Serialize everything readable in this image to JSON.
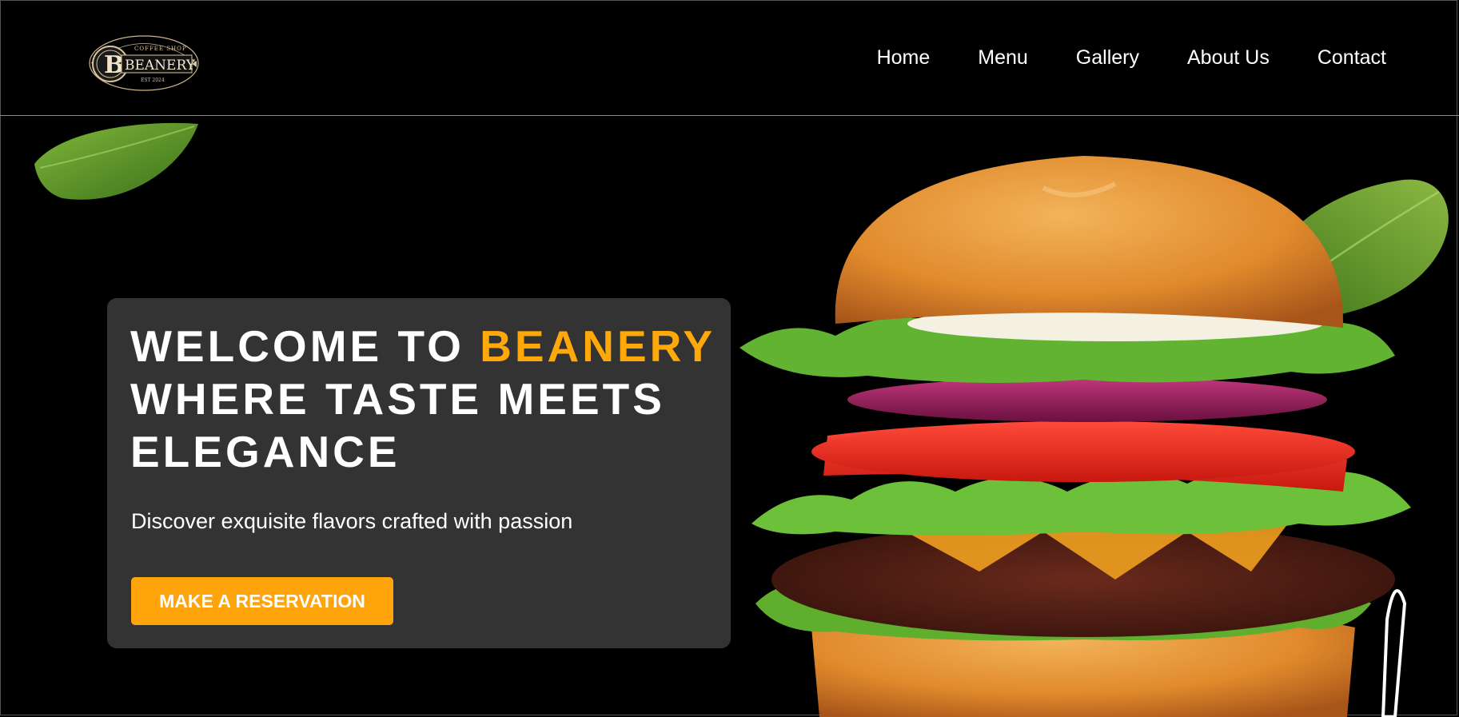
{
  "header": {
    "logo": {
      "brand_text": "BEANERY",
      "top_text": "COFFEE SHOP",
      "bottom_text": "EST 2024"
    },
    "nav": [
      {
        "label": "Home"
      },
      {
        "label": "Menu"
      },
      {
        "label": "Gallery"
      },
      {
        "label": "About Us"
      },
      {
        "label": "Contact"
      }
    ]
  },
  "hero": {
    "headline_prefix": "WELCOME TO ",
    "headline_brand": "BEANERY",
    "headline_rest": "WHERE TASTE MEETS ELEGANCE",
    "subtitle": "Discover exquisite flavors crafted with passion",
    "cta_label": "MAKE A RESERVATION"
  },
  "colors": {
    "background": "#000000",
    "card": "#343334",
    "accent": "#ffa80a",
    "text": "#ffffff"
  },
  "icons": [
    "beanery-logo",
    "leaf-image",
    "burger-image"
  ]
}
